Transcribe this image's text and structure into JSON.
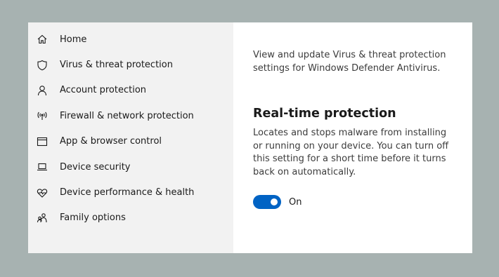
{
  "sidebar": {
    "items": [
      {
        "label": "Home",
        "icon": "home-icon"
      },
      {
        "label": "Virus & threat protection",
        "icon": "shield-icon"
      },
      {
        "label": "Account protection",
        "icon": "person-icon"
      },
      {
        "label": "Firewall & network protection",
        "icon": "wifi-signal-icon"
      },
      {
        "label": "App & browser control",
        "icon": "browser-window-icon"
      },
      {
        "label": "Device security",
        "icon": "laptop-icon"
      },
      {
        "label": "Device performance & health",
        "icon": "heart-pulse-icon"
      },
      {
        "label": "Family options",
        "icon": "family-icon"
      }
    ]
  },
  "main": {
    "intro": "View and update Virus & threat protection settings for Windows Defender Antivirus.",
    "section_title": "Real-time protection",
    "section_desc": "Locates and stops malware from installing or running on your device. You can turn off this setting for a short time before it turns back on automatically.",
    "toggle": {
      "state_label": "On",
      "on": true
    }
  },
  "colors": {
    "accent": "#0063c4",
    "sidebar_bg": "#f2f2f2",
    "backdrop": "#a7b2b1"
  }
}
